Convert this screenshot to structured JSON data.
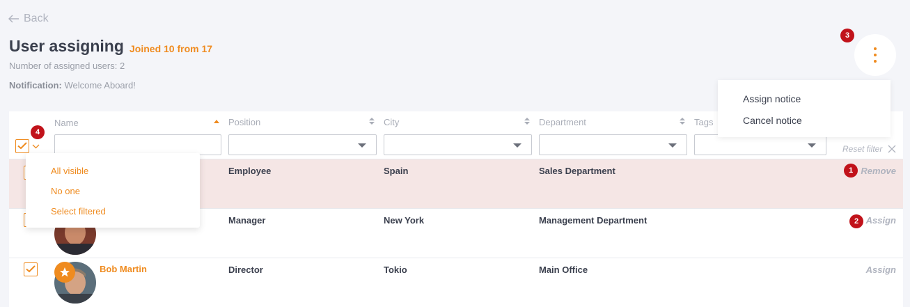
{
  "header": {
    "back_label": "Back",
    "title": "User assigning",
    "joined": "Joined 10 from 17",
    "assigned_count": "Number of assigned users: 2",
    "notification_label": "Notification:",
    "notification_value": "Welcome Aboard!"
  },
  "menu": {
    "items": [
      "Assign notice",
      "Cancel notice"
    ]
  },
  "badges": [
    "1",
    "2",
    "3",
    "4"
  ],
  "columns": {
    "name": "Name",
    "position": "Position",
    "city": "City",
    "department": "Department",
    "tags": "Tags"
  },
  "filters": {
    "reset_label": "Reset filter"
  },
  "select_dropdown": {
    "items": [
      "All visible",
      "No one",
      "Select filtered"
    ]
  },
  "rows": [
    {
      "name": "",
      "position": "Employee",
      "city": "Spain",
      "department": "Sales Department",
      "action": "Remove"
    },
    {
      "name": "",
      "position": "Manager",
      "city": "New York",
      "department": "Management Department",
      "action": "Assign"
    },
    {
      "name": "Bob Martin",
      "position": "Director",
      "city": "Tokio",
      "department": "Main Office",
      "action": "Assign"
    }
  ],
  "colors": {
    "accent": "#ef8b1f",
    "badge": "#c1121a",
    "highlight_row": "#f5e6e5",
    "muted": "#b0b4bf"
  },
  "icons": {
    "back": "arrow-left-icon",
    "more": "kebab-icon",
    "sort": "sort-icon",
    "caret": "caret-down-icon",
    "check": "check-icon",
    "close": "close-icon",
    "star": "star-icon"
  }
}
